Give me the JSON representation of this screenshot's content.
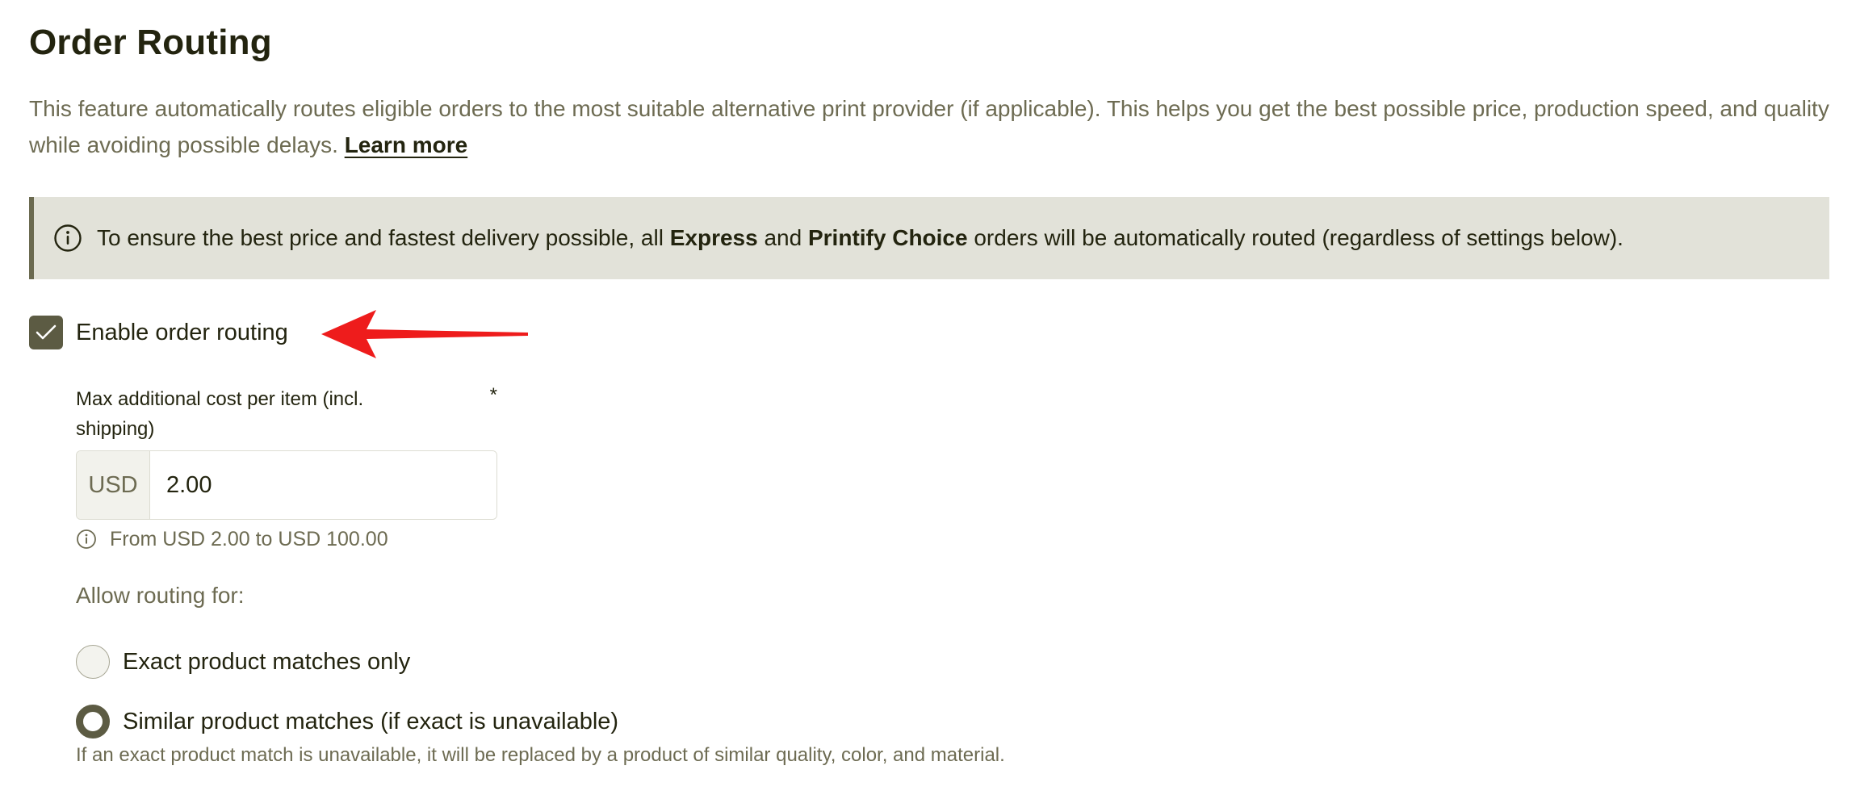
{
  "page": {
    "title": "Order Routing",
    "description": "This feature automatically routes eligible orders to the most suitable alternative print provider (if applicable). This helps you get the best possible price, production speed, and quality while avoiding possible delays.",
    "learn_more_label": "Learn more"
  },
  "notice": {
    "icon": "info-circle-icon",
    "text_before": "To ensure the best price and fastest delivery possible, all",
    "bold_1": "Express",
    "text_middle": "and",
    "bold_2": "Printify Choice",
    "text_after": "orders will be automatically routed (regardless of settings below)."
  },
  "enable_routing": {
    "label": "Enable order routing",
    "checked": true
  },
  "annotation": {
    "arrow_color": "#ee1c1c"
  },
  "max_cost": {
    "label": "Max additional cost per item (incl. shipping)",
    "required_marker": "*",
    "currency": "USD",
    "value": "2.00",
    "hint": "From USD 2.00 to USD 100.00"
  },
  "routing_options": {
    "label": "Allow routing for:",
    "options": [
      {
        "label": "Exact product matches only",
        "selected": false
      },
      {
        "label": "Similar product matches (if exact is unavailable)",
        "selected": true
      }
    ],
    "selected_help": "If an exact product match is unavailable, it will be replaced by a product of similar quality, color, and material."
  },
  "colors": {
    "primary": "#5c5b43",
    "notice_bg": "#e2e2d9",
    "text_dark": "#23240f",
    "text_muted": "#6d6b52"
  }
}
